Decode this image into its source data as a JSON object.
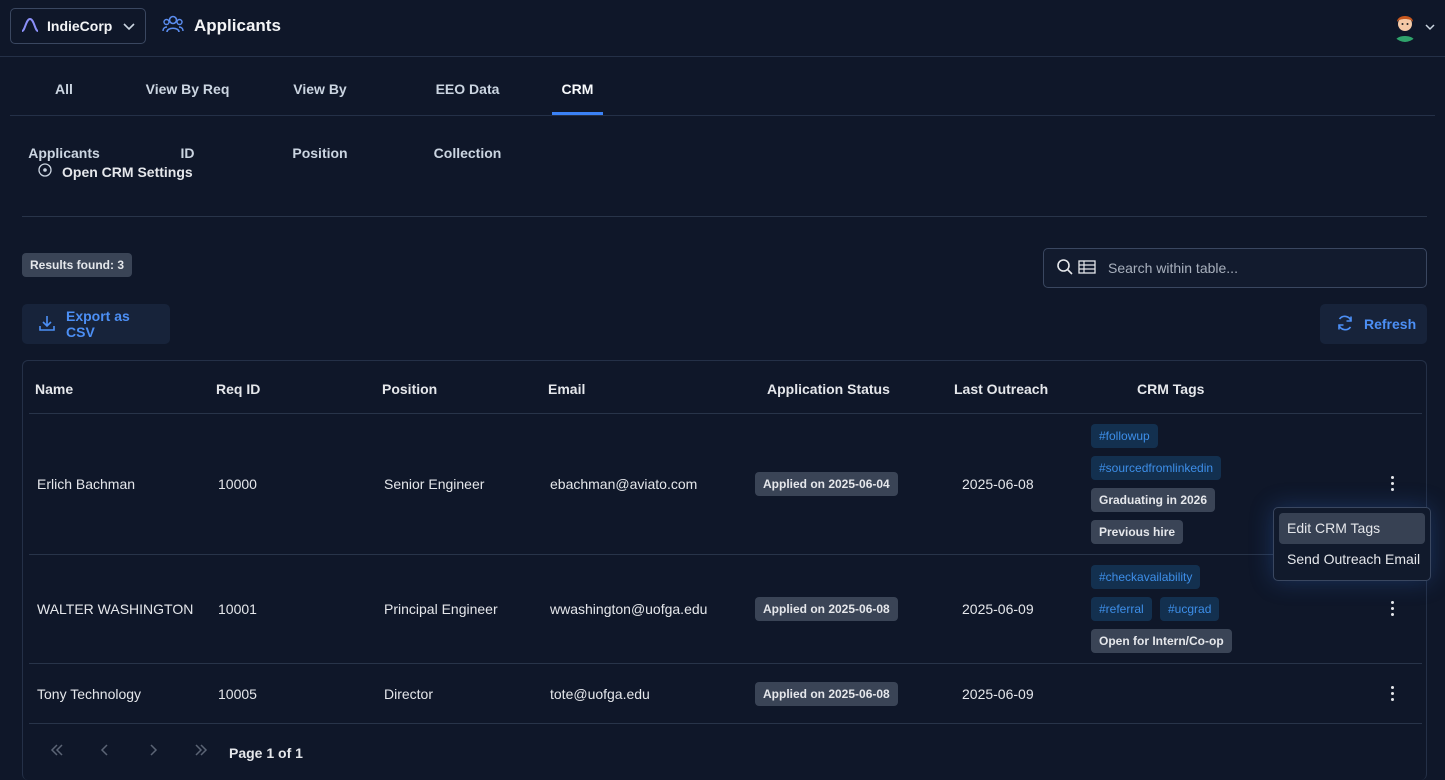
{
  "app": {
    "org_name": "IndieCorp",
    "page_title": "Applicants"
  },
  "tabs": [
    {
      "label": "All Applicants"
    },
    {
      "label": "View By Req ID"
    },
    {
      "label": "View By Position"
    },
    {
      "label": "EEO Data Collection"
    },
    {
      "label": "CRM",
      "active": true
    }
  ],
  "crm_settings_label": "Open CRM Settings",
  "results_badge": "Results found: 3",
  "search": {
    "placeholder": "Search within table..."
  },
  "toolbar": {
    "export_label": "Export as CSV",
    "refresh_label": "Refresh"
  },
  "table": {
    "columns": [
      "Name",
      "Req ID",
      "Position",
      "Email",
      "Application Status",
      "Last Outreach",
      "CRM Tags"
    ],
    "rows": [
      {
        "name": "Erlich Bachman",
        "req_id": "10000",
        "position": "Senior Engineer",
        "email": "ebachman@aviato.com",
        "status": "Applied on 2025-06-04",
        "last_outreach": "2025-06-08",
        "tags": [
          "#followup",
          "#sourcedfromlinkedin",
          "Graduating in 2026",
          "Previous hire"
        ]
      },
      {
        "name": "WALTER WASHINGTON",
        "req_id": "10001",
        "position": "Principal Engineer",
        "email": "wwashington@uofga.edu",
        "status": "Applied on 2025-06-08",
        "last_outreach": "2025-06-09",
        "tags": [
          "#checkavailability",
          "#referral",
          "#ucgrad",
          "Open for Intern/Co-op"
        ]
      },
      {
        "name": "Tony Technology",
        "req_id": "10005",
        "position": "Director",
        "email": "tote@uofga.edu",
        "status": "Applied on 2025-06-08",
        "last_outreach": "2025-06-09",
        "tags": []
      }
    ]
  },
  "pagination": {
    "label": "Page 1 of 1"
  },
  "context_menu": {
    "items": [
      "Edit CRM Tags",
      "Send Outreach Email"
    ]
  },
  "colors": {
    "accent": "#3b82f6",
    "background": "#0f1729",
    "hash_tag_text": "#3d8ee8"
  }
}
